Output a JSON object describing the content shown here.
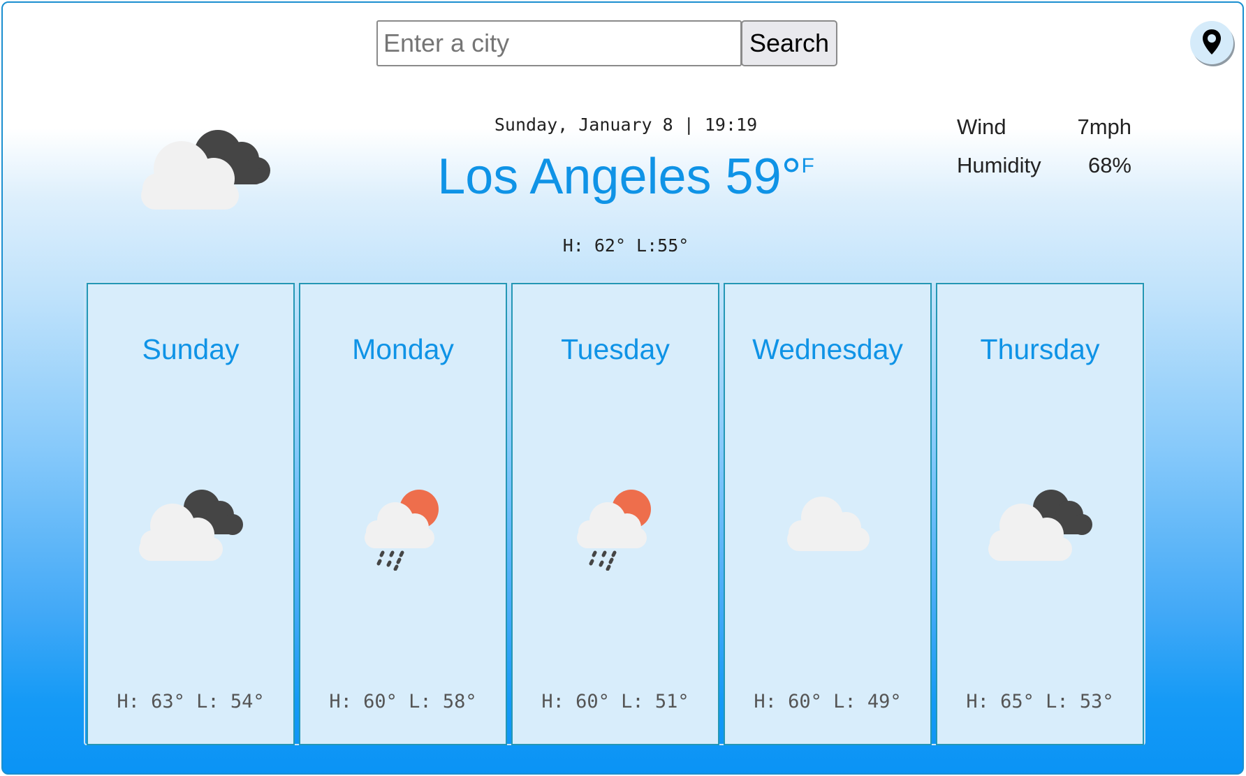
{
  "search": {
    "placeholder": "Enter a city",
    "value": "",
    "button_label": "Search"
  },
  "location_button": {
    "icon": "map-pin-icon"
  },
  "current": {
    "datetime": "Sunday, January 8 | 19:19",
    "city": "Los Angeles",
    "temperature": "59°",
    "unit": "F",
    "hilo": "H: 62° L:55°",
    "icon": "partly-cloudy-night-icon",
    "wind_label": "Wind",
    "wind_value": "7mph",
    "humidity_label": "Humidity",
    "humidity_value": "68%"
  },
  "forecast": [
    {
      "day": "Sunday",
      "temps": "H: 63° L: 54°",
      "icon": "cloudy-dark-icon"
    },
    {
      "day": "Monday",
      "temps": "H: 60° L: 58°",
      "icon": "rain-sun-icon"
    },
    {
      "day": "Tuesday",
      "temps": "H: 60° L: 51°",
      "icon": "rain-sun-icon"
    },
    {
      "day": "Wednesday",
      "temps": "H: 60° L: 49°",
      "icon": "cloud-icon"
    },
    {
      "day": "Thursday",
      "temps": "H: 65° L: 53°",
      "icon": "cloudy-dark-icon"
    }
  ],
  "colors": {
    "accent": "#0f93e6",
    "card_bg": "#d8edfb",
    "card_border": "#2497b5",
    "sun": "#ee6e4c",
    "dark_cloud": "#454545",
    "light_cloud": "#f1f1f1"
  }
}
